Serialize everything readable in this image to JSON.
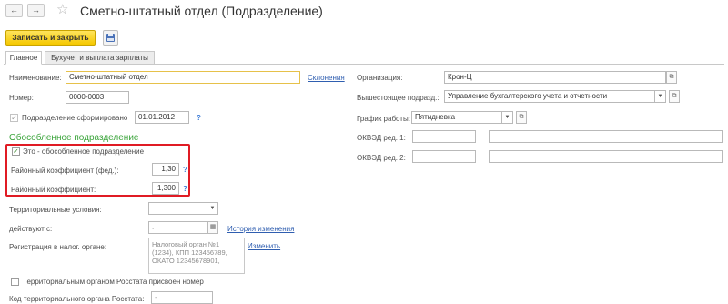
{
  "window": {
    "title": "Сметно-штатный отдел (Подразделение)"
  },
  "nav": {
    "back_glyph": "←",
    "forward_glyph": "→",
    "favorite_glyph": "☆"
  },
  "toolbar": {
    "save_close_label": "Записать и закрыть"
  },
  "tabs": [
    {
      "label": "Главное",
      "active": true
    },
    {
      "label": "Бухучет и выплата зарплаты",
      "active": false
    }
  ],
  "left": {
    "name_label": "Наименование:",
    "name_value": "Сметно-штатный отдел",
    "declensions_link": "Склонения",
    "number_label": "Номер:",
    "number_value": "0000-0003",
    "formed_label": "Подразделение сформировано",
    "formed_date": "01.01.2012",
    "formed_checked": true,
    "separate_header": "Обособленное подразделение",
    "separate_checkbox_label": "Это - обособленное подразделение",
    "separate_checked": true,
    "coef_fed_label": "Районный коэффициент (фед.):",
    "coef_fed_value": "1,30",
    "coef_label": "Районный коэффициент:",
    "coef_value": "1,300",
    "territorial_label": "Территориальные условия:",
    "territorial_value": "",
    "valid_from_label": "действуют с:",
    "valid_from_value": ". .",
    "history_link": "История изменения",
    "tax_reg_label": "Регистрация в налог. органе:",
    "tax_reg_lines": [
      "Налоговый орган №1",
      "(1234), КПП 123456789,",
      "ОКАТО 12345678901,"
    ],
    "change_link": "Изменить",
    "rosstat_checkbox_label": "Территориальным органом Росстата присвоен номер",
    "rosstat_checked": false,
    "rosstat_code_label": "Код территориального органа Росстата:",
    "rosstat_code_value": "-"
  },
  "right": {
    "org_label": "Организация:",
    "org_value": "Крон-Ц",
    "parent_label": "Вышестоящее подразд.:",
    "parent_value": "Управление бухгалтерского учета и отчетности",
    "schedule_label": "График работы:",
    "schedule_value": "Пятидневка",
    "okved1_label": "ОКВЭД ред. 1:",
    "okved1_code": "",
    "okved1_name": "",
    "okved2_label": "ОКВЭД ред. 2:",
    "okved2_code": "",
    "okved2_name": ""
  },
  "help_glyph": "?",
  "colors": {
    "primary_button": "#f5c800",
    "highlight_box": "#e01b24",
    "section_header": "#3aa43a",
    "link": "#2f5eb0"
  }
}
